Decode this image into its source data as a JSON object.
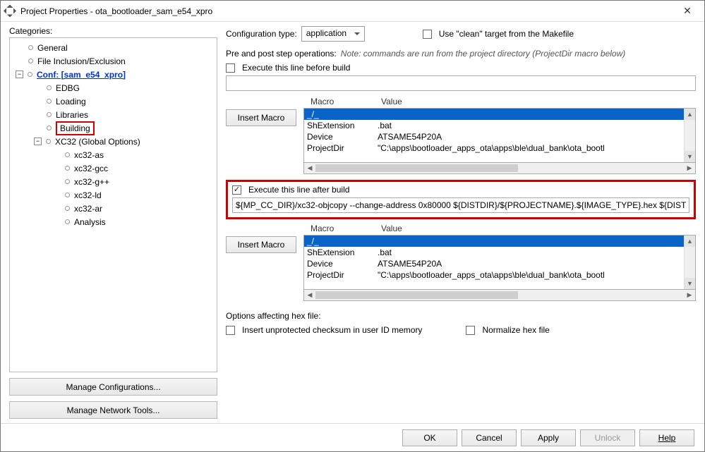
{
  "window": {
    "title": "Project Properties - ota_bootloader_sam_e54_xpro"
  },
  "left": {
    "categories_label": "Categories:",
    "tree": {
      "general": "General",
      "file_ie": "File Inclusion/Exclusion",
      "conf": "Conf: [sam_e54_xpro]",
      "edbg": "EDBG",
      "loading": "Loading",
      "libraries": "Libraries",
      "building": "Building",
      "xc32": "XC32 (Global Options)",
      "xc32_as": "xc32-as",
      "xc32_gcc": "xc32-gcc",
      "xc32_gpp": "xc32-g++",
      "xc32_ld": "xc32-ld",
      "xc32_ar": "xc32-ar",
      "analysis": "Analysis"
    },
    "manage_conf": "Manage Configurations...",
    "manage_net": "Manage Network Tools..."
  },
  "right": {
    "config_type_label": "Configuration type:",
    "config_type_value": "application",
    "clean_target": "Use \"clean\" target from the Makefile",
    "prepost_label": "Pre and post step operations:",
    "prepost_note": "Note: commands are run from the project directory (ProjectDir macro below)",
    "exec_before_label": "Execute this line before build",
    "before_value": "",
    "insert_macro": "Insert Macro",
    "headers": {
      "macro": "Macro",
      "value": "Value"
    },
    "exec_after_label": "Execute this line after build",
    "after_value": "${MP_CC_DIR}/xc32-objcopy --change-address 0x80000 ${DISTDIR}/${PROJECTNAME}.${IMAGE_TYPE}.hex ${DISTDIR}/",
    "options_label": "Options affecting hex file:",
    "insert_checksum": "Insert unprotected checksum in user ID memory",
    "normalize": "Normalize hex file",
    "macro_table": {
      "rows": [
        {
          "macro": "_/_",
          "value": ""
        },
        {
          "macro": "ShExtension",
          "value": ".bat"
        },
        {
          "macro": "Device",
          "value": "ATSAME54P20A"
        },
        {
          "macro": "ProjectDir",
          "value": "\"C:\\apps\\bootloader_apps_ota\\apps\\ble\\dual_bank\\ota_bootl"
        }
      ]
    }
  },
  "footer": {
    "ok": "OK",
    "cancel": "Cancel",
    "apply": "Apply",
    "unlock": "Unlock",
    "help": "Help"
  }
}
